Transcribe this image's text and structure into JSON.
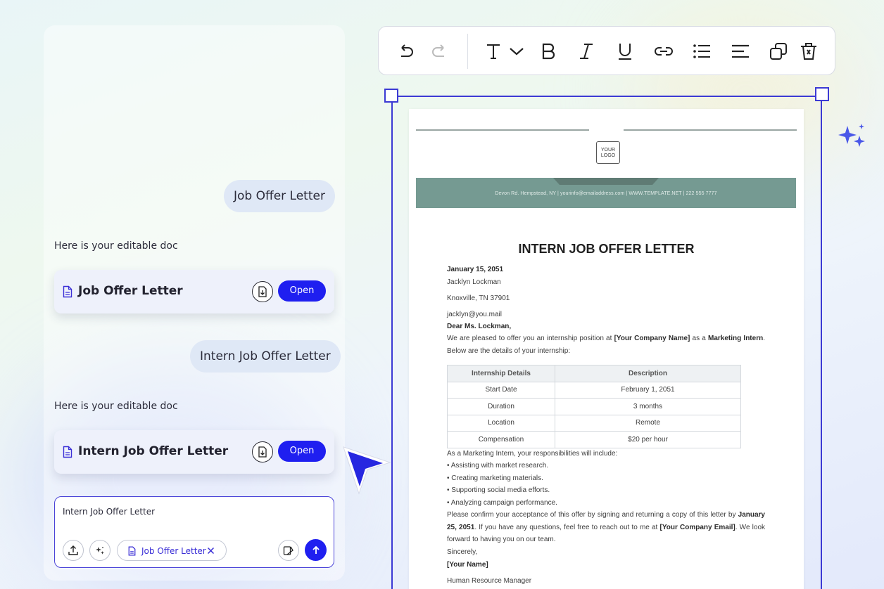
{
  "chat": {
    "messages": [
      {
        "type": "user",
        "text": "Job Offer Letter"
      },
      {
        "type": "assistant",
        "text": "Here is your editable doc",
        "card_title": "Job Offer Letter",
        "open_label": "Open",
        "download_icon": "download-icon"
      },
      {
        "type": "user",
        "text": "Intern Job Offer Letter"
      },
      {
        "type": "assistant",
        "text": "Here is your editable doc",
        "card_title": "Intern Job Offer Letter",
        "open_label": "Open",
        "download_icon": "download-icon"
      }
    ],
    "input": {
      "value": "Intern Job Offer Letter",
      "chip_label": "Job Offer Letter",
      "upload_icon": "upload-icon",
      "magic_icon": "sparkle-icon",
      "template_icon": "template-icon",
      "send_icon": "arrow-up-icon"
    }
  },
  "toolbar": {
    "icons": [
      "undo-icon",
      "redo-icon",
      "text-style-icon",
      "chevron-down-icon",
      "bold-icon",
      "italic-icon",
      "underline-icon",
      "link-icon",
      "list-icon",
      "align-icon",
      "duplicate-icon",
      "delete-icon"
    ]
  },
  "document": {
    "logo_line1": "YOUR",
    "logo_line2": "LOGO",
    "contact_band": "Devon Rd. Hempstead, NY | yourinfo@emailaddress.com | WWW.TEMPLATE.NET | 222 555 7777",
    "title": "INTERN JOB OFFER LETTER",
    "date": "January 15, 2051",
    "recipient_name": "Jacklyn Lockman",
    "recipient_city": "Knoxville, TN 37901",
    "recipient_email": "jacklyn@you.mail",
    "salutation": "Dear Ms. Lockman,",
    "intro_1": "We are pleased to offer you an internship position at ",
    "intro_company": "[Your Company Name]",
    "intro_2": " as a ",
    "intro_role": "Marketing Intern",
    "intro_3": ". Below are the details of your internship:",
    "table": {
      "headers": [
        "Internship Details",
        "Description"
      ],
      "rows": [
        [
          "Start Date",
          "February 1, 2051"
        ],
        [
          "Duration",
          "3 months"
        ],
        [
          "Location",
          "Remote"
        ],
        [
          "Compensation",
          "$20 per hour"
        ]
      ]
    },
    "responsibilities_intro": "As a Marketing Intern, your responsibilities will include:",
    "responsibilities": [
      "Assisting with market research.",
      "Creating marketing materials.",
      "Supporting social media efforts.",
      "Analyzing campaign performance."
    ],
    "confirm_1": "Please confirm your acceptance of this offer by signing and returning a copy of this letter by ",
    "confirm_date": "January 25, 2051",
    "confirm_2": ". If you have any questions, feel free to reach out to me at ",
    "confirm_email": "[Your Company Email]",
    "confirm_3": ". We look forward to having you on our team.",
    "closing": "Sincerely,",
    "signer": "[Your Name]",
    "signer_title": "Human Resource Manager"
  },
  "colors": {
    "accent": "#1f1ff0",
    "selection": "#3c3ad4",
    "band": "#759a92"
  }
}
